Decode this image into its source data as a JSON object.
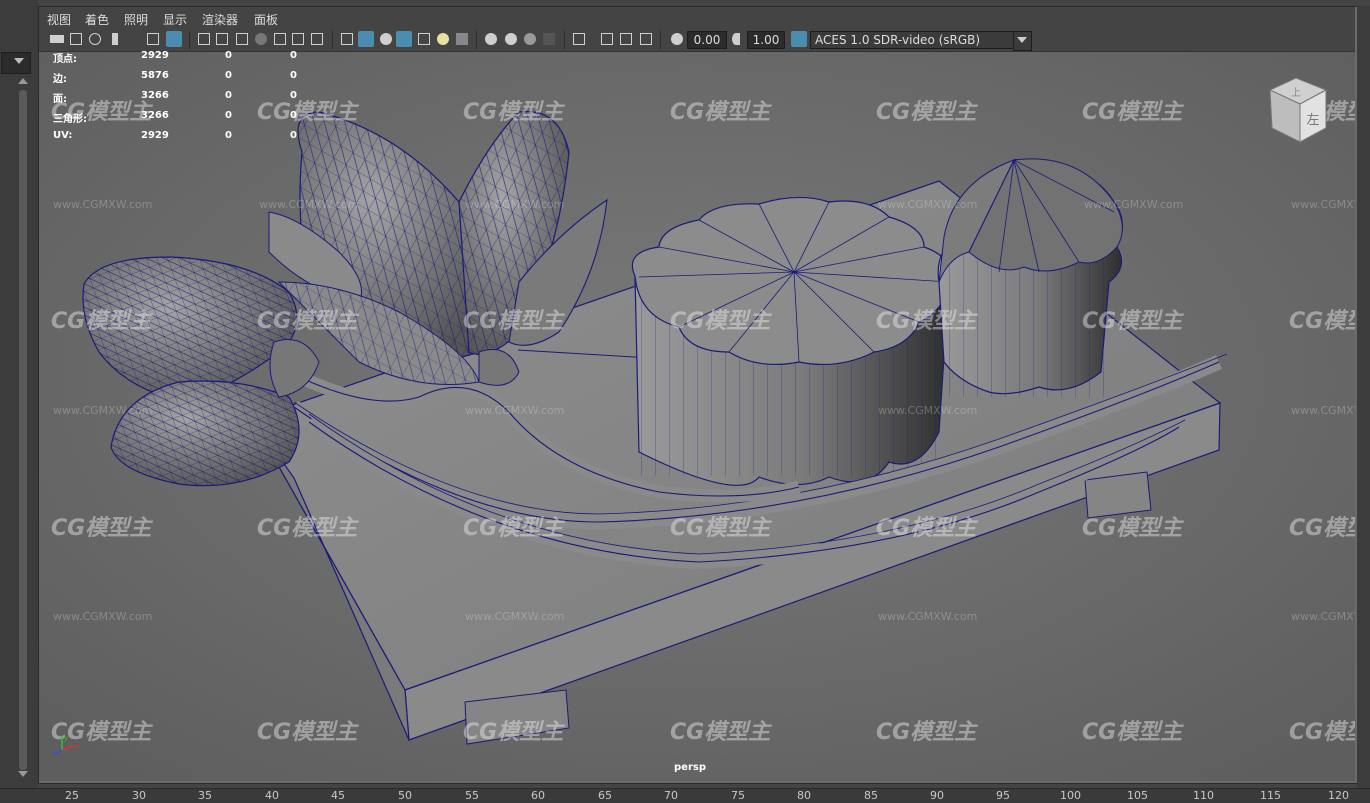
{
  "menu": [
    "视图",
    "着色",
    "照明",
    "显示",
    "渲染器",
    "面板"
  ],
  "toolbar": {
    "exposure_value": "0.00",
    "gamma_value": "1.00",
    "color_space": "ACES 1.0 SDR-video (sRGB)"
  },
  "hud": {
    "rows": [
      {
        "label": "顶点:",
        "v1": "2929",
        "v2": "0",
        "v3": "0"
      },
      {
        "label": "边:",
        "v1": "5876",
        "v2": "0",
        "v3": "0"
      },
      {
        "label": "面:",
        "v1": "3266",
        "v2": "0",
        "v3": "0"
      },
      {
        "label": "三角形:",
        "v1": "3266",
        "v2": "0",
        "v3": "0"
      },
      {
        "label": "UV:",
        "v1": "2929",
        "v2": "0",
        "v3": "0"
      }
    ]
  },
  "viewport": {
    "camera": "persp",
    "view_cube_labels": [
      "上",
      "左"
    ],
    "axis_labels": [
      "x",
      "y",
      "z"
    ],
    "wireframe_color": "#1a1a7a",
    "mesh_color": "#8a8a8a"
  },
  "watermark": {
    "brand": "CG模型主",
    "url": "www.CGMXW.com"
  },
  "ruler": {
    "ticks": [
      "25",
      "30",
      "35",
      "40",
      "45",
      "50",
      "55",
      "60",
      "65",
      "70",
      "75",
      "80",
      "85",
      "90",
      "95",
      "100",
      "105",
      "110",
      "115",
      "120"
    ]
  }
}
